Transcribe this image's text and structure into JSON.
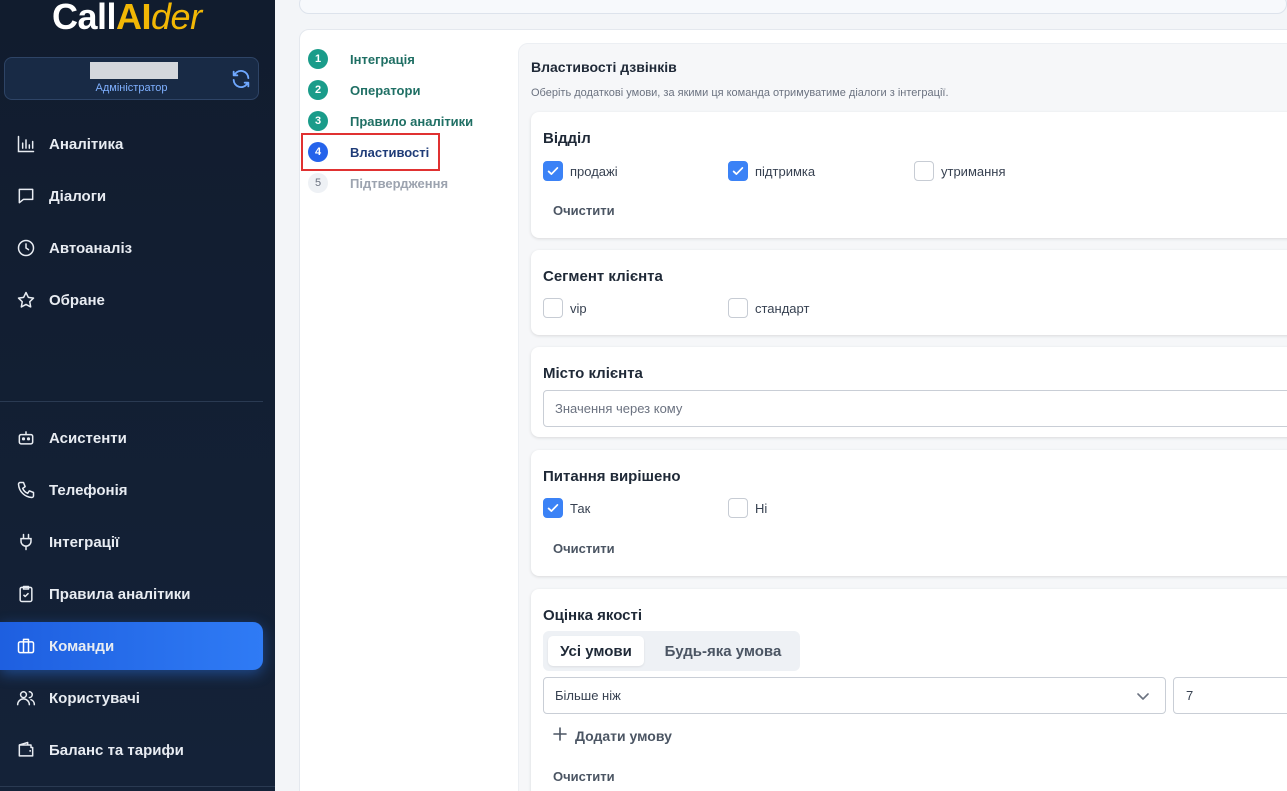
{
  "brand": {
    "part1": "Call",
    "part2": "AI",
    "part3": "der"
  },
  "user": {
    "role": "Адміністратор"
  },
  "nav_top": [
    {
      "label": "Аналітика",
      "icon": "bar-chart-icon"
    },
    {
      "label": "Діалоги",
      "icon": "chat-icon"
    },
    {
      "label": "Автоаналіз",
      "icon": "clock-icon"
    },
    {
      "label": "Обране",
      "icon": "star-icon"
    }
  ],
  "nav_bottom": [
    {
      "label": "Асистенти",
      "icon": "robot-icon"
    },
    {
      "label": "Телефонія",
      "icon": "phone-icon"
    },
    {
      "label": "Інтеграції",
      "icon": "plug-icon"
    },
    {
      "label": "Правила аналітики",
      "icon": "clipboard-check-icon"
    },
    {
      "label": "Команди",
      "icon": "briefcase-icon",
      "active": true
    },
    {
      "label": "Користувачі",
      "icon": "users-icon"
    },
    {
      "label": "Баланс та тарифи",
      "icon": "wallet-icon"
    }
  ],
  "steps": [
    {
      "num": "1",
      "label": "Інтеграція",
      "state": "done"
    },
    {
      "num": "2",
      "label": "Оператори",
      "state": "done"
    },
    {
      "num": "3",
      "label": "Правило аналітики",
      "state": "done"
    },
    {
      "num": "4",
      "label": "Властивості",
      "state": "current"
    },
    {
      "num": "5",
      "label": "Підтвердження",
      "state": "pending"
    }
  ],
  "panel": {
    "title": "Властивості дзвінків",
    "subtitle": "Оберіть додаткові умови, за якими ця команда отримуватиме діалоги з інтеграції."
  },
  "department": {
    "title": "Відділ",
    "options": [
      {
        "label": "продажі",
        "checked": true
      },
      {
        "label": "підтримка",
        "checked": true
      },
      {
        "label": "утримання",
        "checked": false
      }
    ],
    "clear": "Очистити"
  },
  "segment": {
    "title": "Сегмент клієнта",
    "options": [
      {
        "label": "vip",
        "checked": false
      },
      {
        "label": "стандарт",
        "checked": false
      }
    ]
  },
  "city": {
    "title": "Місто клієнта",
    "placeholder": "Значення через кому"
  },
  "resolved": {
    "title": "Питання вирішено",
    "options": [
      {
        "label": "Так",
        "checked": true
      },
      {
        "label": "Ні",
        "checked": false
      }
    ],
    "clear": "Очистити"
  },
  "quality": {
    "title": "Оцінка якості",
    "mode_all": "Усі умови",
    "mode_any": "Будь-яка умова",
    "operator": "Більше ніж",
    "value": "7",
    "add": "Додати умову",
    "clear": "Очистити"
  },
  "colors": {
    "accent": "#2563eb",
    "step_done": "#1a9c8a",
    "sidebar_bg": "#111c2e",
    "highlight": "#e03131"
  }
}
